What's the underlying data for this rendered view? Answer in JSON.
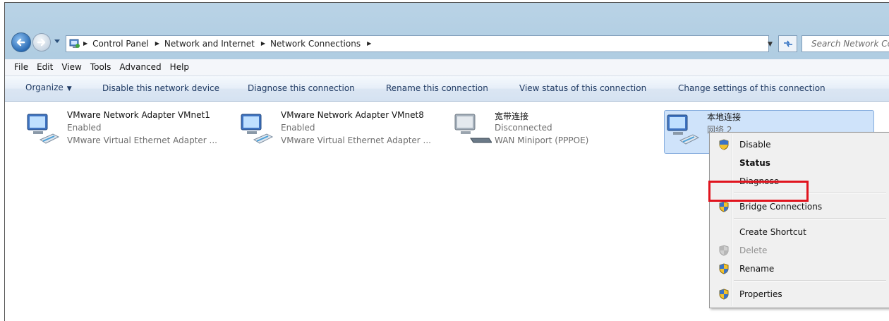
{
  "address": {
    "crumbs": [
      "Control Panel",
      "Network and Internet",
      "Network Connections"
    ],
    "search_placeholder": "Search Network Connections"
  },
  "menubar": [
    "File",
    "Edit",
    "View",
    "Tools",
    "Advanced",
    "Help"
  ],
  "commands": {
    "organize": "Organize",
    "disable": "Disable this network device",
    "diagnose": "Diagnose this connection",
    "rename": "Rename this connection",
    "view_status": "View status of this connection",
    "change_settings": "Change settings of this connection"
  },
  "connections": [
    {
      "name": "VMware Network Adapter VMnet1",
      "status": "Enabled",
      "device": "VMware Virtual Ethernet Adapter ...",
      "icon": "network-adapter-icon"
    },
    {
      "name": "VMware Network Adapter VMnet8",
      "status": "Enabled",
      "device": "VMware Virtual Ethernet Adapter ...",
      "icon": "network-adapter-icon"
    },
    {
      "name": "宽带连接",
      "status": "Disconnected",
      "device": "WAN Miniport (PPPOE)",
      "icon": "broadband-modem-icon"
    },
    {
      "name": "本地连接",
      "status": "网络 2",
      "device": "",
      "icon": "network-adapter-icon",
      "selected": true
    }
  ],
  "context_menu": {
    "items": [
      {
        "label": "Disable",
        "icon": "uac-shield-icon"
      },
      {
        "label": "Status",
        "bold": true
      },
      {
        "label": "Diagnose"
      },
      {
        "label": "Bridge Connections",
        "icon": "uac-shield-icon"
      },
      {
        "label": "Create Shortcut"
      },
      {
        "label": "Delete",
        "icon": "uac-shield-icon",
        "disabled": true
      },
      {
        "label": "Rename",
        "icon": "uac-shield-icon"
      },
      {
        "label": "Properties",
        "icon": "uac-shield-icon",
        "highlighted": true
      }
    ]
  },
  "colors": {
    "highlight_border": "#e0141e",
    "selection": "#cfe3fa",
    "command_text": "#1f3a63"
  }
}
